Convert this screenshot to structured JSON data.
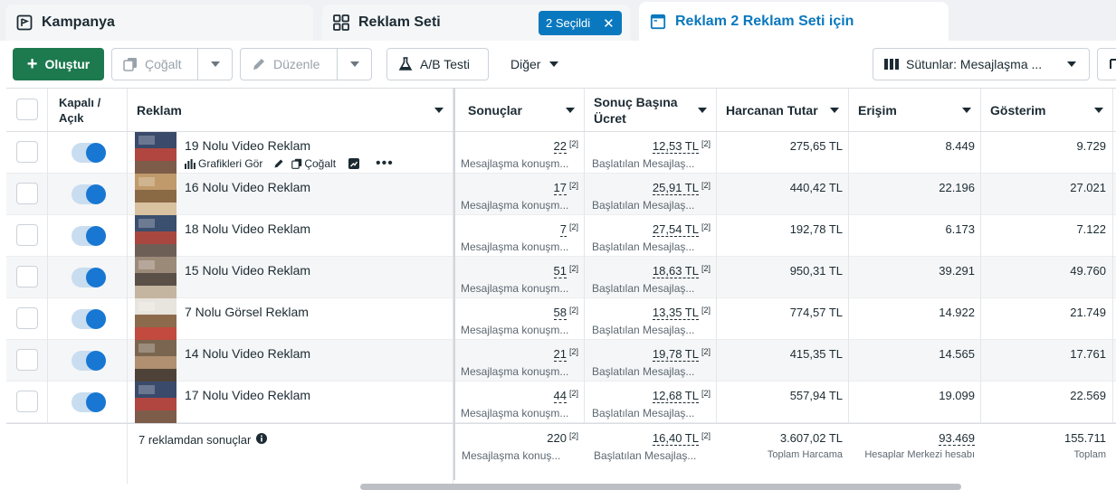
{
  "tabs": {
    "campaign": "Kampanya",
    "adset": "Reklam Seti",
    "adset_selected": "2 Seçildi",
    "ad": "Reklam 2 Reklam Seti için"
  },
  "toolbar": {
    "create": "Oluştur",
    "duplicate": "Çoğalt",
    "edit": "Düzenle",
    "ab_test": "A/B Testi",
    "other": "Diğer",
    "columns": "Sütunlar: Mesajlaşma ..."
  },
  "headers": {
    "onoff": "Kapalı / Açık",
    "ad": "Reklam",
    "results": "Sonuçlar",
    "cpr": "Sonuç Başına Ücret",
    "spend": "Harcanan Tutar",
    "reach": "Erişim",
    "impressions": "Gösterim"
  },
  "row_actions": {
    "charts": "Grafikleri Gör",
    "duplicate": "Çoğalt"
  },
  "rows": [
    {
      "name": "19 Nolu Video Reklam",
      "results": "22",
      "results_sub": "Mesajlaşma konuşm...",
      "cpr": "12,53 TL",
      "cpr_sub": "Başlatılan Mesajlaş...",
      "spend": "275,65 TL",
      "reach": "8.449",
      "impressions": "9.729"
    },
    {
      "name": "16 Nolu Video Reklam",
      "results": "17",
      "results_sub": "Mesajlaşma konuşm...",
      "cpr": "25,91 TL",
      "cpr_sub": "Başlatılan Mesajlaş...",
      "spend": "440,42 TL",
      "reach": "22.196",
      "impressions": "27.021"
    },
    {
      "name": "18 Nolu Video Reklam",
      "results": "7",
      "results_sub": "Mesajlaşma konuşm...",
      "cpr": "27,54 TL",
      "cpr_sub": "Başlatılan Mesajlaş...",
      "spend": "192,78 TL",
      "reach": "6.173",
      "impressions": "7.122"
    },
    {
      "name": "15 Nolu Video Reklam",
      "results": "51",
      "results_sub": "Mesajlaşma konuşm...",
      "cpr": "18,63 TL",
      "cpr_sub": "Başlatılan Mesajlaş...",
      "spend": "950,31 TL",
      "reach": "39.291",
      "impressions": "49.760"
    },
    {
      "name": "7 Nolu Görsel Reklam",
      "results": "58",
      "results_sub": "Mesajlaşma konuşm...",
      "cpr": "13,35 TL",
      "cpr_sub": "Başlatılan Mesajlaş...",
      "spend": "774,57 TL",
      "reach": "14.922",
      "impressions": "21.749"
    },
    {
      "name": "14 Nolu Video Reklam",
      "results": "21",
      "results_sub": "Mesajlaşma konuşm...",
      "cpr": "19,78 TL",
      "cpr_sub": "Başlatılan Mesajlaş...",
      "spend": "415,35 TL",
      "reach": "14.565",
      "impressions": "17.761"
    },
    {
      "name": "17 Nolu Video Reklam",
      "results": "44",
      "results_sub": "Mesajlaşma konuşm...",
      "cpr": "12,68 TL",
      "cpr_sub": "Başlatılan Mesajlaş...",
      "spend": "557,94 TL",
      "reach": "19.099",
      "impressions": "22.569"
    }
  ],
  "footer": {
    "label": "7 reklamdan sonuçlar",
    "results": "220",
    "results_sub": "Mesajlaşma konuş...",
    "cpr": "16,40 TL",
    "cpr_sub": "Başlatılan Mesajlaş...",
    "spend": "3.607,02 TL",
    "spend_sub": "Toplam Harcama",
    "reach": "93.469",
    "reach_sub": "Hesaplar Merkezi hesabı",
    "impressions": "155.711",
    "impressions_sub": "Toplam"
  },
  "superscript": "[2]"
}
